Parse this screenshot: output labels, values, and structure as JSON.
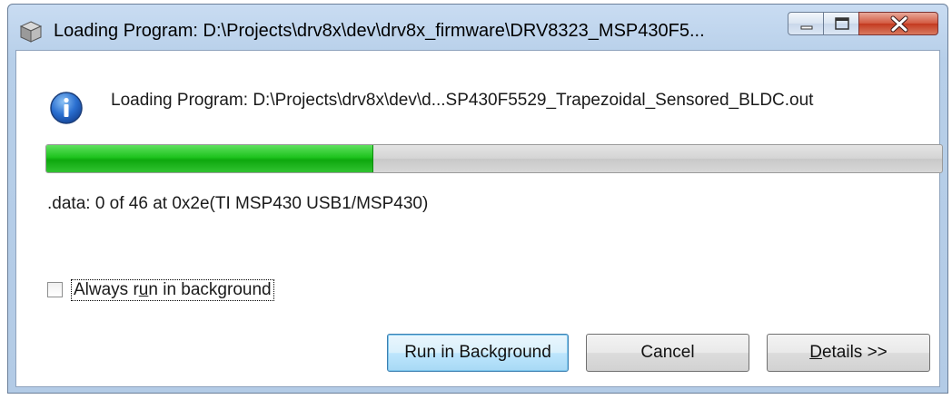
{
  "window": {
    "title": "Loading Program: D:\\Projects\\drv8x\\dev\\drv8x_firmware\\DRV8323_MSP430F5..."
  },
  "dialog": {
    "icon": "info-icon",
    "message": "Loading Program: D:\\Projects\\drv8x\\dev\\d...SP430F5529_Trapezoidal_Sensored_BLDC.out",
    "progress_percent": 36.5,
    "status": ".data: 0 of 46 at 0x2e(TI MSP430 USB1/MSP430)",
    "checkbox": {
      "checked": false,
      "label_before": "Always r",
      "label_accel": "u",
      "label_after": "n in background"
    }
  },
  "buttons": {
    "run_in_background": "Run in Background",
    "cancel": "Cancel",
    "details_accel": "D",
    "details_rest": "etails >>"
  },
  "colors": {
    "progress_fill": "#1ec31e",
    "title_bar": "#c9dcf2",
    "close_button": "#c4391f"
  }
}
